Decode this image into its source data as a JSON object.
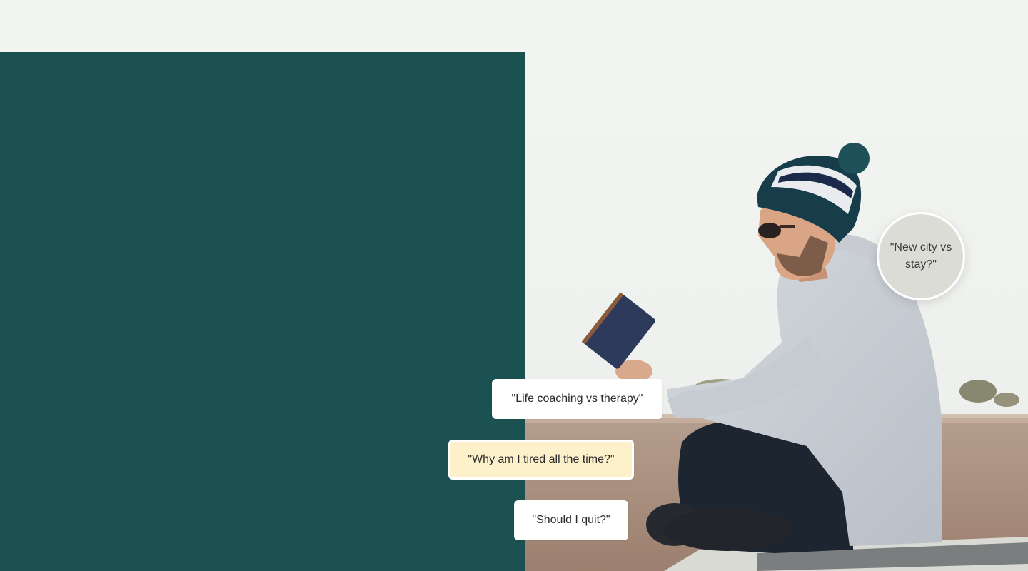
{
  "hero": {
    "image": "man-reading-book-photo",
    "colors": {
      "panel": "#1b5150",
      "sky": "#f1f4f1",
      "highlight_pill": "#fdf1cb",
      "bubble": "#dcdcd7"
    }
  },
  "queries": {
    "life_coaching": "\"Life coaching vs therapy\"",
    "tired": "\"Why am I tired all the time?\"",
    "quit": "\"Should I quit?\"",
    "new_city": "\"New city vs stay?\""
  }
}
